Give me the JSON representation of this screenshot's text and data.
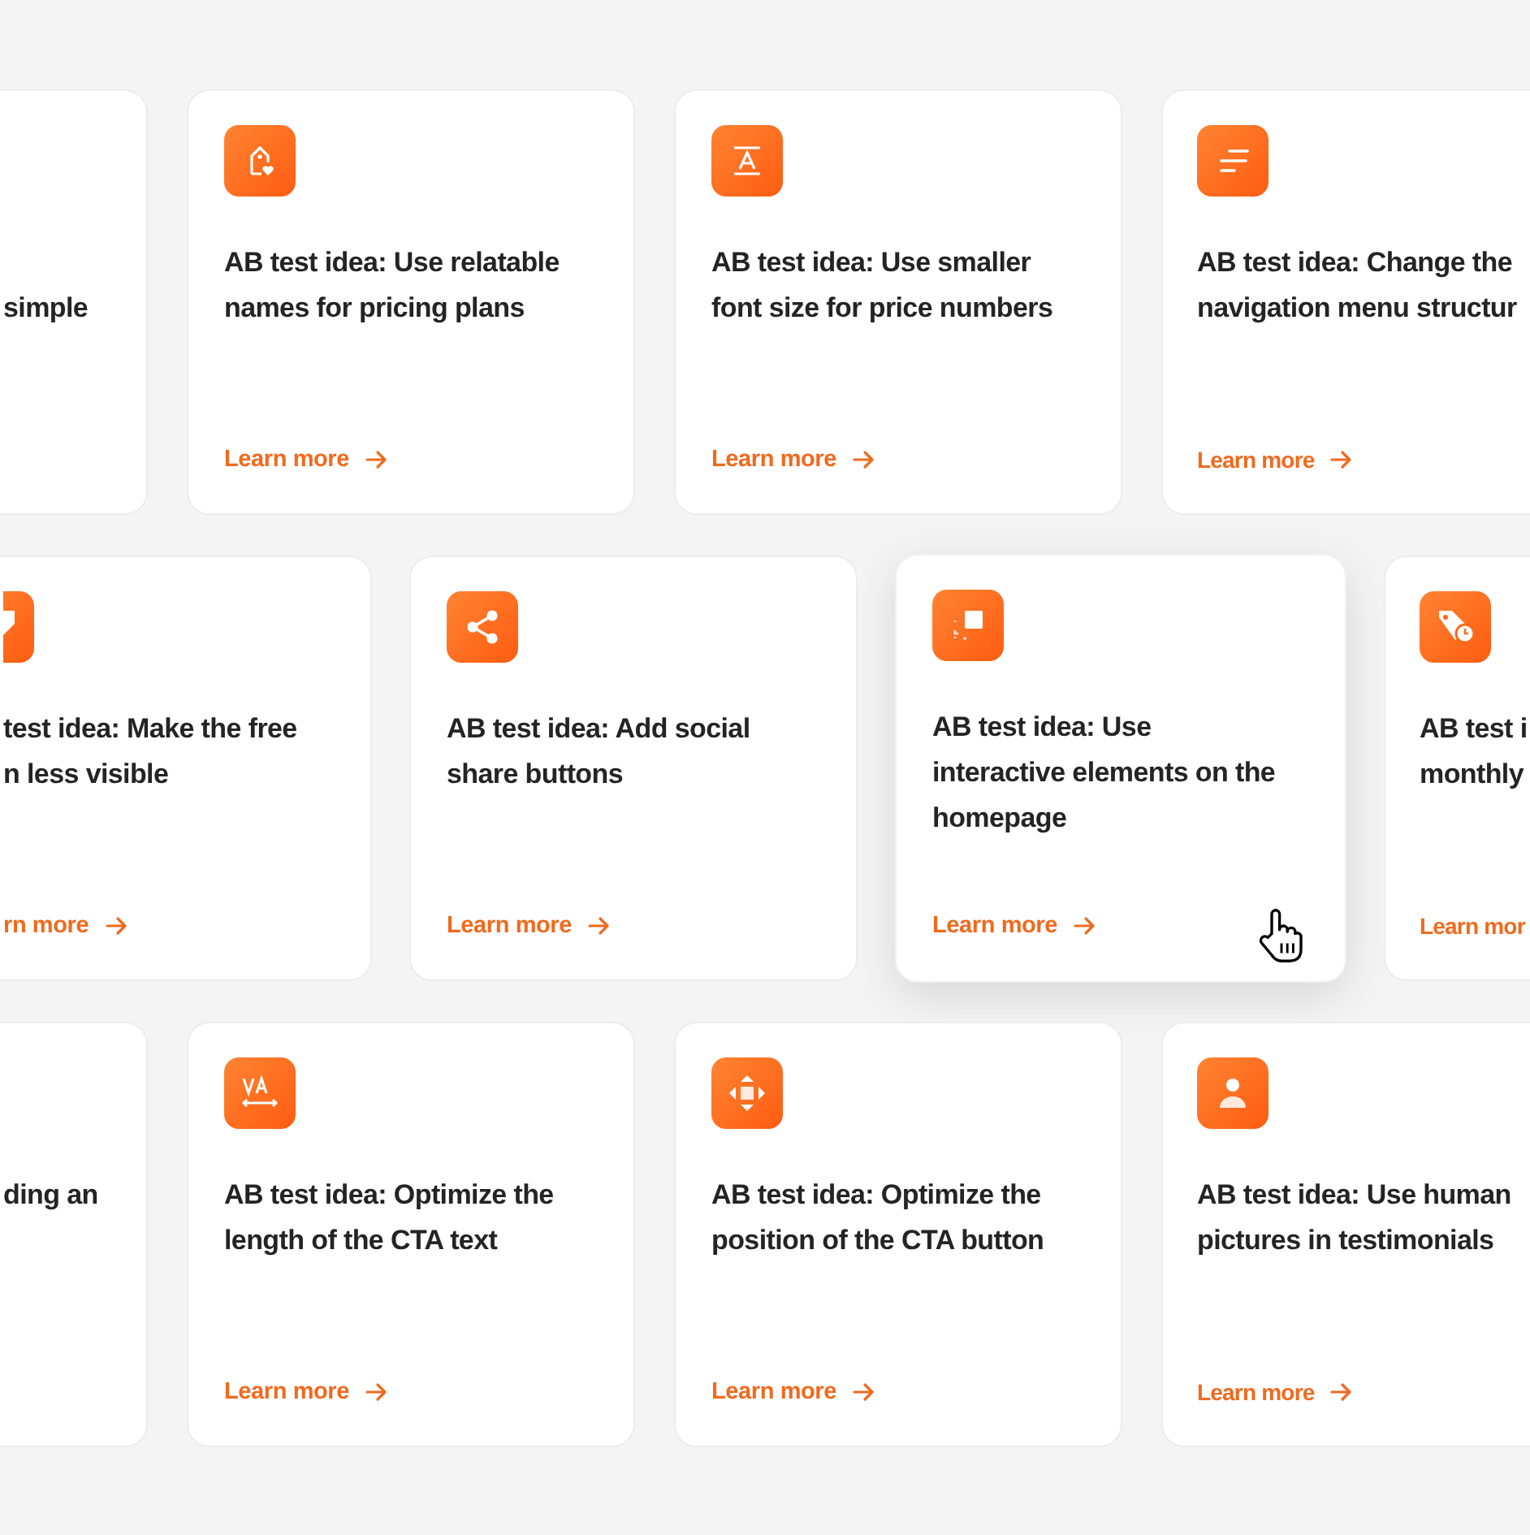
{
  "rows": [
    {
      "cards": [
        {
          "hovered": false,
          "title_lines": [
            "simple"
          ]
        },
        {
          "hovered": false,
          "kind": "tag-heart",
          "title_lines": [
            "AB test idea: Use relatable",
            "names for pricing plans"
          ],
          "link": "Learn more"
        },
        {
          "hovered": false,
          "kind": "text-size",
          "title_lines": [
            "AB test idea: Use smaller",
            "font size for price numbers"
          ],
          "link": "Learn more"
        },
        {
          "hovered": false,
          "kind": "lines",
          "title_lines": [
            "AB test idea: Change the",
            "navigation menu structur"
          ],
          "link": "Learn more"
        }
      ]
    },
    {
      "cards": [
        {
          "hovered": false,
          "kind": "tag",
          "title_lines": [
            "test idea: Make the free",
            "n less visible"
          ],
          "link": "rn more"
        },
        {
          "hovered": false,
          "kind": "share",
          "title_lines": [
            "AB test idea: Add social",
            "share buttons"
          ],
          "link": "Learn more"
        },
        {
          "hovered": true,
          "kind": "select",
          "title_lines": [
            "AB test idea: Use",
            "interactive elements on the",
            "homepage"
          ],
          "link": "Learn more"
        },
        {
          "hovered": false,
          "kind": "tag-clock",
          "title_lines": [
            "AB test i",
            "monthly"
          ],
          "link": "Learn mor"
        }
      ]
    },
    {
      "cards": [
        {
          "hovered": false,
          "title_lines": [
            "ding an"
          ]
        },
        {
          "hovered": false,
          "kind": "va-width",
          "title_lines": [
            "AB test idea: Optimize the",
            "length of the CTA text"
          ],
          "link": "Learn more"
        },
        {
          "hovered": false,
          "kind": "move",
          "title_lines": [
            "AB test idea: Optimize the",
            "position of the CTA button"
          ],
          "link": "Learn more"
        },
        {
          "hovered": false,
          "kind": "person",
          "title_lines": [
            "AB test idea: Use human",
            "pictures in testimonials"
          ],
          "link": "Learn more"
        }
      ]
    }
  ]
}
